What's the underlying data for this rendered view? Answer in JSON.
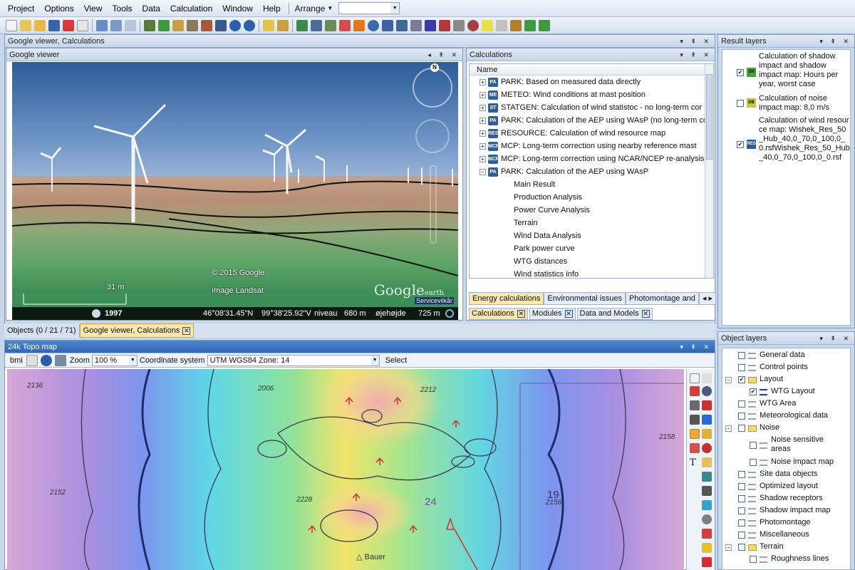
{
  "menu": {
    "items": [
      "Project",
      "Options",
      "View",
      "Tools",
      "Data",
      "Calculation",
      "Window",
      "Help"
    ],
    "arrange": "Arrange"
  },
  "colors": {
    "accent": "#2f66b3",
    "tab_selected": "#fbe7b0",
    "panel_border": "#7f9db9"
  },
  "top_group": {
    "title": "Google viewer, Calculations"
  },
  "google_viewer": {
    "title": "Google viewer",
    "compass_label": "N",
    "scale": "31 m",
    "copyright": "© 2015 Google",
    "imagery": "Image Landsat",
    "logo": "Google",
    "logo_sub": "earth",
    "services": "Servicevilkår",
    "year": "1997",
    "lat": "46°08'31.45\"N",
    "lon": "99°38'25.92\"V",
    "niveau_label": "niveau",
    "niveau_value": "680 m",
    "eye_label": "øjehøjde",
    "eye_value": "725 m"
  },
  "calculations": {
    "title": "Calculations",
    "column": "Name",
    "rows": [
      {
        "icon": "PA",
        "label": "PARK: Based on measured data directly",
        "expander": "+"
      },
      {
        "icon": "ME",
        "label": "METEO: Wind conditions at mast position",
        "expander": "+"
      },
      {
        "icon": "ST",
        "label": "STATGEN: Calculation of wind statistoc - no long-term cor",
        "expander": "+"
      },
      {
        "icon": "PA",
        "label": "PARK: Calculation of the AEP using WAsP (no long-term co",
        "expander": "+"
      },
      {
        "icon": "RES",
        "label": "RESOURCE: Calculation of wind resource map",
        "expander": "+"
      },
      {
        "icon": "MCP",
        "label": "MCP: Long-term correction using nearby reference mast",
        "expander": "+"
      },
      {
        "icon": "MCP",
        "label": "MCP: Long-term correction using NCAR/NCEP re-analysis d",
        "expander": "+"
      },
      {
        "icon": "PA",
        "label": "PARK: Calculation of the AEP using WAsP",
        "expander": "−"
      }
    ],
    "subrows": [
      "Main Result",
      "Production Analysis",
      "Power Curve Analysis",
      "Terrain",
      "Wind Data Analysis",
      "Park power curve",
      "WTG distances",
      "Wind statistics info"
    ],
    "category_tabs": [
      "Energy calculations",
      "Environmental issues",
      "Photomontage and"
    ],
    "bottom_tabs": [
      "Calculations",
      "Modules",
      "Data and Models"
    ]
  },
  "doc_tabs": [
    "Objects (0 / 21 / 71)",
    "Google viewer, Calculations"
  ],
  "map": {
    "title": "24k Topo map",
    "bmi": "bmi",
    "zoom_label": "Zoom",
    "zoom_value": "100 %",
    "coord_label": "Coordinate system",
    "coord_value": "UTM WGS84 Zone: 14",
    "select_label": "Select",
    "elevations": [
      "2136",
      "2006",
      "2212",
      "2152",
      "2228",
      "2156",
      "2158",
      "24"
    ],
    "section": "19",
    "place_name": "Bauer"
  },
  "result_layers": {
    "title": "Result layers",
    "items": [
      {
        "icon": "SH",
        "checked": true,
        "label": "Calculation of shadow impact and shadow impact map: Hours per year, worst case"
      },
      {
        "icon": "DB",
        "checked": false,
        "label": "Calculation of noise impact map: 8,0 m/s"
      },
      {
        "icon": "RES",
        "checked": true,
        "label": "Calculation of wind resource map: Wishek_Res_50_Hub_40,0_70,0_100,0_0.rsfWishek_Res_50_Hub_40,0_70,0_100,0_0.rsf"
      }
    ]
  },
  "object_layers": {
    "title": "Object layers",
    "items": [
      "General data",
      "Control points",
      "Layout",
      "WTG Layout",
      "WTG Area",
      "Meteorological data",
      "Noise",
      "Noise sensitive areas",
      "Noise impact map",
      "Site data objects",
      "Optimized layout",
      "Shadow receptors",
      "Shadow impact map",
      "Photomontage",
      "Miscellaneous",
      "Terrain",
      "Roughness lines"
    ]
  }
}
